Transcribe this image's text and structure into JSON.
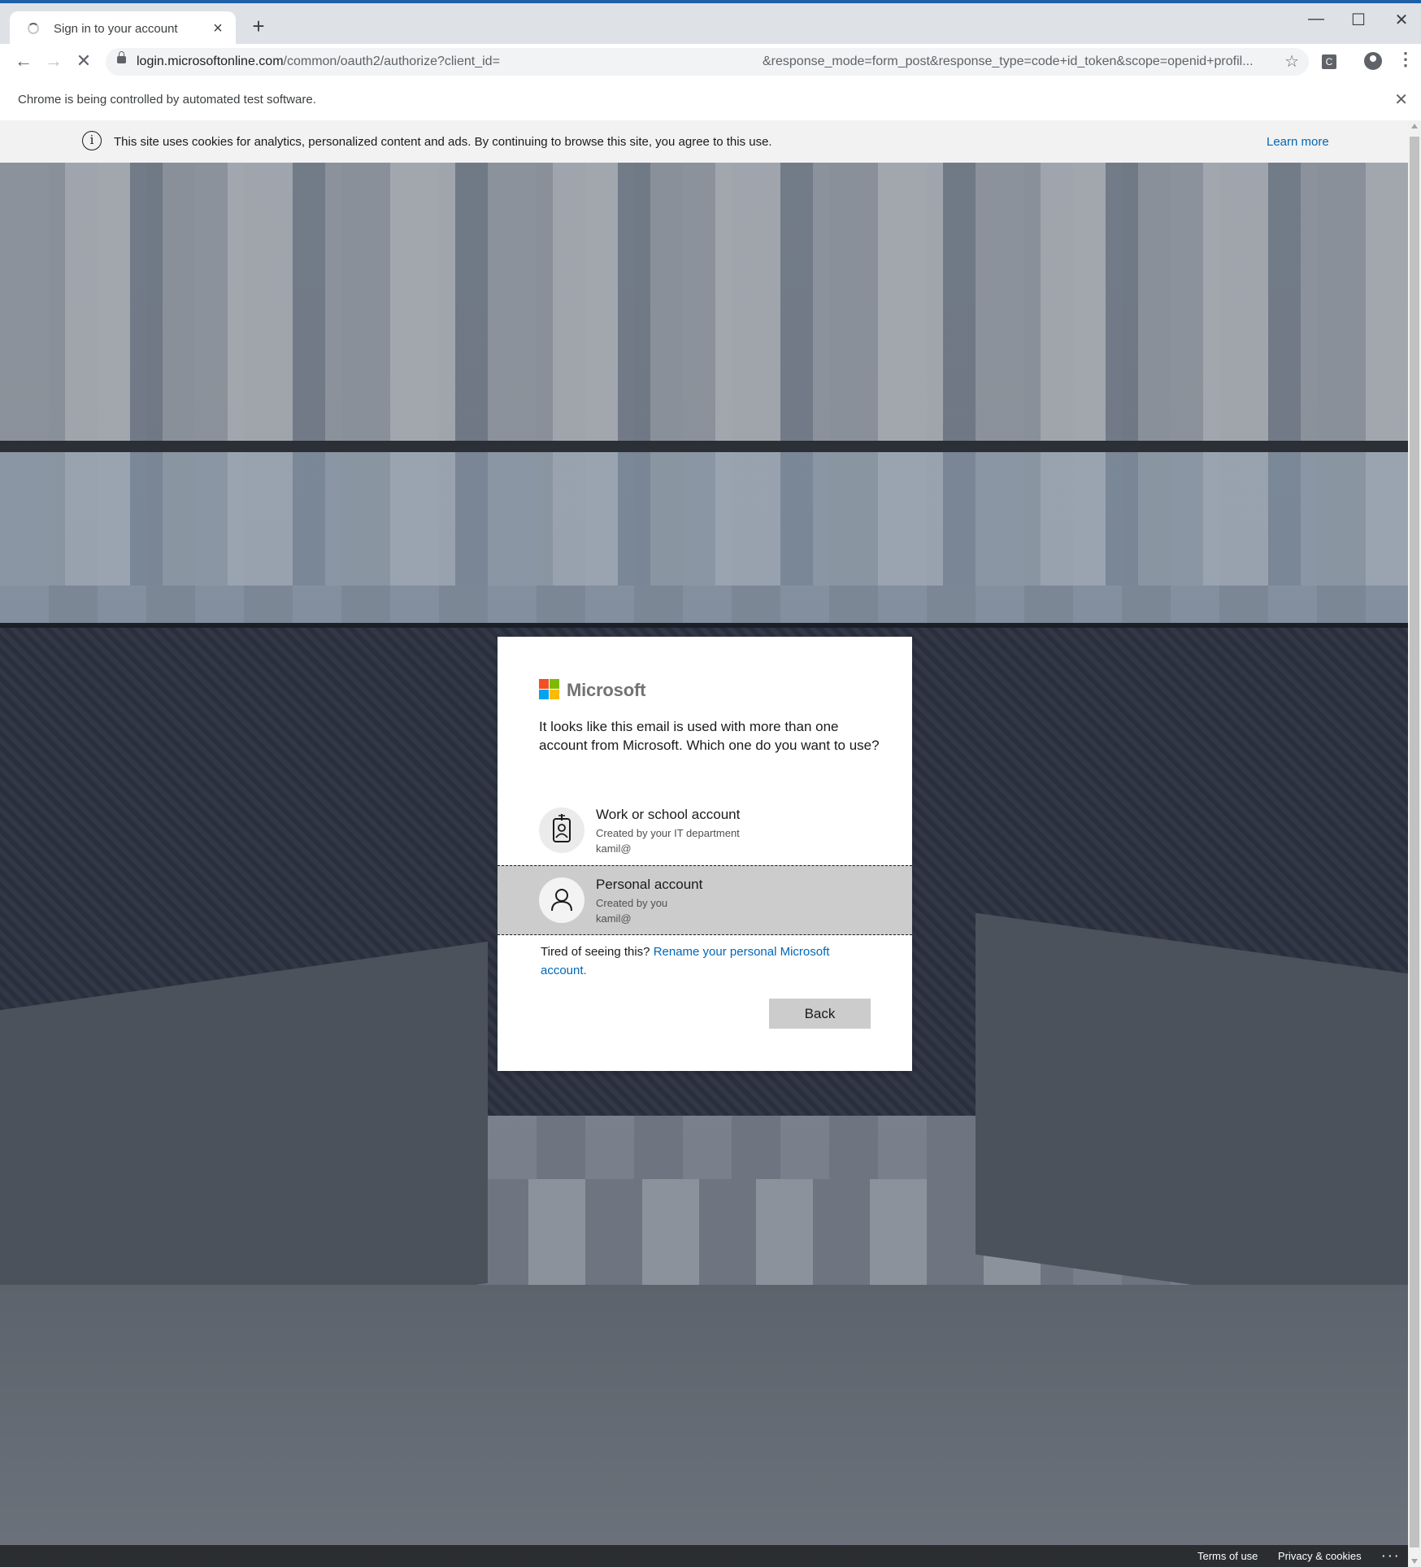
{
  "browser": {
    "tab_title": "Sign in to your account",
    "tab_close": "×",
    "new_tab": "+",
    "window": {
      "minimize": "—",
      "maximize": "☐",
      "close": "✕"
    },
    "nav": {
      "back": "←",
      "forward": "→",
      "reload": "✕"
    },
    "url_host": "login.microsoftonline.com",
    "url_path": "/common/oauth2/authorize?client_id=",
    "url_tail": "&response_mode=form_post&response_type=code+id_token&scope=openid+profil...",
    "bookmark_icon": "star-icon",
    "extension_label": "C",
    "menu": "⋮",
    "automation_message": "Chrome is being controlled by automated test software.",
    "automation_close": "✕"
  },
  "cookie_banner": {
    "icon": "i",
    "text": "This site uses cookies for analytics, personalized content and ads. By continuing to browse this site, you agree to this use.",
    "learn_more": "Learn more"
  },
  "dialog": {
    "brand": "Microsoft",
    "brand_colors": [
      "#f25022",
      "#7fba00",
      "#00a4ef",
      "#ffb900"
    ],
    "prompt": "It looks like this email is used with more than one account from Microsoft. Which one do you want to use?",
    "accounts": [
      {
        "name": "Work or school account",
        "description": "Created by your IT department",
        "email": "kamil@",
        "icon": "badge-icon",
        "selected": false
      },
      {
        "name": "Personal account",
        "description": "Created by you",
        "email": "kamil@",
        "icon": "person-icon",
        "selected": true
      }
    ],
    "tired_text": "Tired of seeing this? ",
    "rename_link": "Rename your personal Microsoft account.",
    "back_button": "Back"
  },
  "footer": {
    "terms": "Terms of use",
    "privacy": "Privacy & cookies",
    "more": "· · ·"
  }
}
